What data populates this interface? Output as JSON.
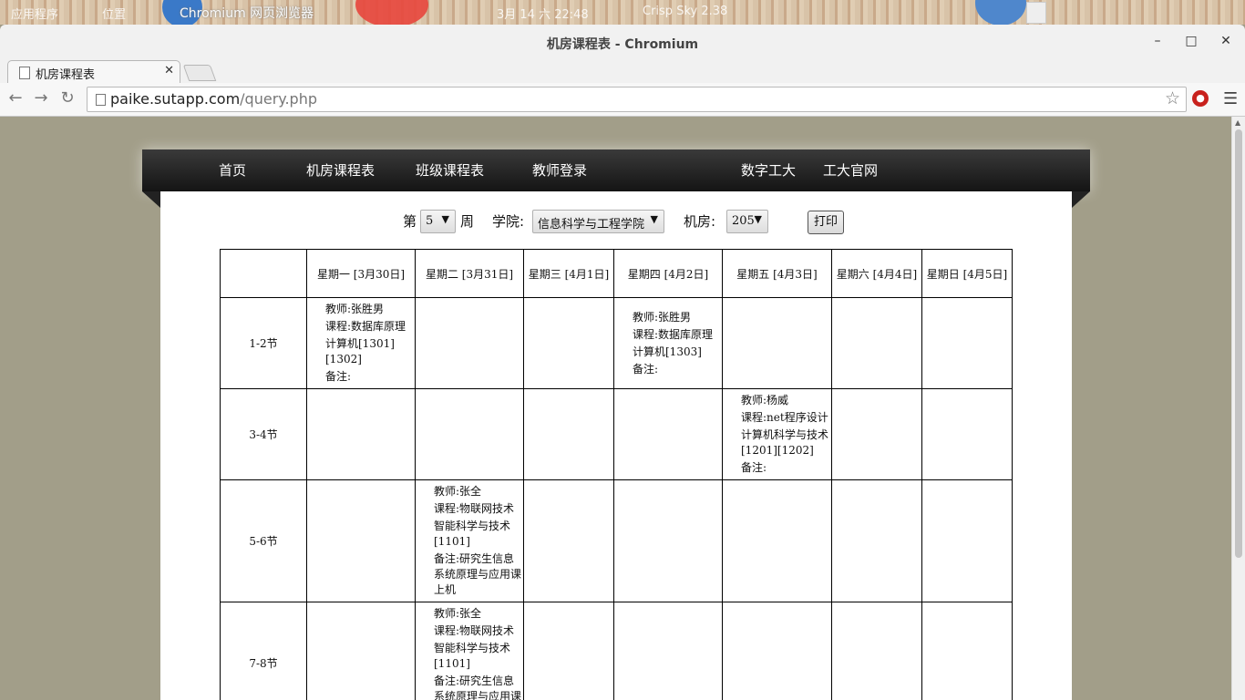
{
  "os_panel": {
    "left_text": "应用程序",
    "second_text": "位置",
    "window_title": "Chromium 网页浏览器",
    "datetime": "3月 14 六 22:48",
    "weather": "Crisp Sky 2.38"
  },
  "window": {
    "title": "机房课程表 - Chromium",
    "minimize": "–",
    "maximize": "□",
    "close": "✕"
  },
  "tab": {
    "label": "机房课程表",
    "close": "✕"
  },
  "omnibox": {
    "host": "paike.sutapp.com",
    "path": "/query.php"
  },
  "icons": {
    "back": "back-arrow-icon",
    "forward": "forward-arrow-icon",
    "reload": "reload-icon",
    "star": "star-icon",
    "menu": "hamburger-menu-icon"
  },
  "site_nav": {
    "items": [
      "首页",
      "机房课程表",
      "班级课程表",
      "教师登录"
    ],
    "right_items": [
      "数字工大",
      "工大官网"
    ]
  },
  "filters": {
    "week_prefix": "第",
    "week_value": "5",
    "week_suffix": "周",
    "college_label": "学院:",
    "college_value": "信息科学与工程学院",
    "room_label": "机房:",
    "room_value": "205",
    "print_label": "打印"
  },
  "schedule": {
    "days": [
      "星期一 [3月30日]",
      "星期二 [3月31日]",
      "星期三 [4月1日]",
      "星期四 [4月2日]",
      "星期五 [4月3日]",
      "星期六 [4月4日]",
      "星期日 [4月5日]"
    ],
    "slots": [
      "1-2节",
      "3-4节",
      "5-6节",
      "7-8节"
    ],
    "entries": {
      "r0_d0": [
        "教师:张胜男",
        "课程:数据库原理",
        "计算机[1301][1302]",
        "备注:"
      ],
      "r0_d3": [
        "教师:张胜男",
        "课程:数据库原理",
        "计算机[1303]",
        "备注:"
      ],
      "r1_d4": [
        "教师:杨威",
        "课程:net程序设计",
        "计算机科学与技术[1201][1202]",
        "备注:"
      ],
      "r2_d1": [
        "教师:张全",
        "课程:物联网技术",
        "智能科学与技术[1101]",
        "备注:研究生信息系统原理与应用课上机"
      ],
      "r3_d1": [
        "教师:张全",
        "课程:物联网技术",
        "智能科学与技术[1101]",
        "备注:研究生信息系统原理与应用课上机"
      ]
    }
  }
}
